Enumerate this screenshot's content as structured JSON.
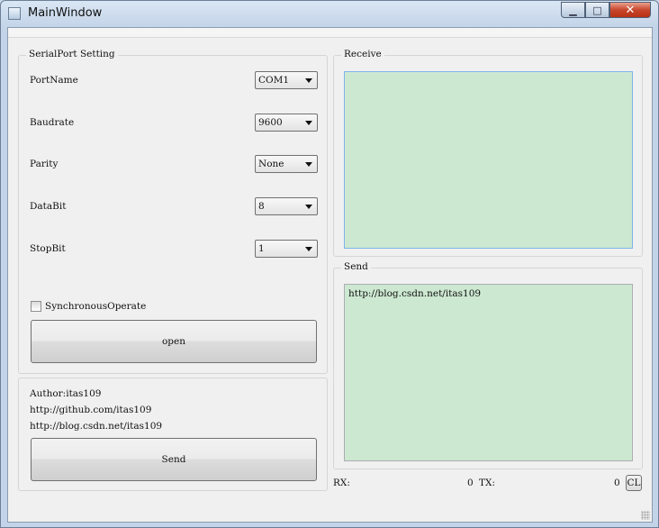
{
  "window": {
    "title": "MainWindow",
    "controls": {
      "minimize": "▁",
      "maximize": "□",
      "close": "✕"
    }
  },
  "serial_settings": {
    "group_title": "SerialPort Setting",
    "fields": [
      {
        "label": "PortName",
        "value": "COM1"
      },
      {
        "label": "Baudrate",
        "value": "9600"
      },
      {
        "label": "Parity",
        "value": "None"
      },
      {
        "label": "DataBit",
        "value": "8"
      },
      {
        "label": "StopBit",
        "value": "1"
      }
    ],
    "sync_checkbox_label": "SynchronousOperate",
    "sync_checked": false,
    "open_button_label": "open"
  },
  "info": {
    "author": "Author:itas109",
    "github": "http://github.com/itas109",
    "blog": "http://blog.csdn.net/itas109",
    "send_button_label": "Send"
  },
  "receive": {
    "group_title": "Receive",
    "content": ""
  },
  "send": {
    "group_title": "Send",
    "content": "http://blog.csdn.net/itas109"
  },
  "status": {
    "rx_label": "RX:",
    "rx_value": "0",
    "tx_label": "TX:",
    "tx_value": "0",
    "clear_button_label": "CL"
  },
  "colors": {
    "text_area_bg": "#cde8d1",
    "window_bg": "#f0f0f0"
  }
}
